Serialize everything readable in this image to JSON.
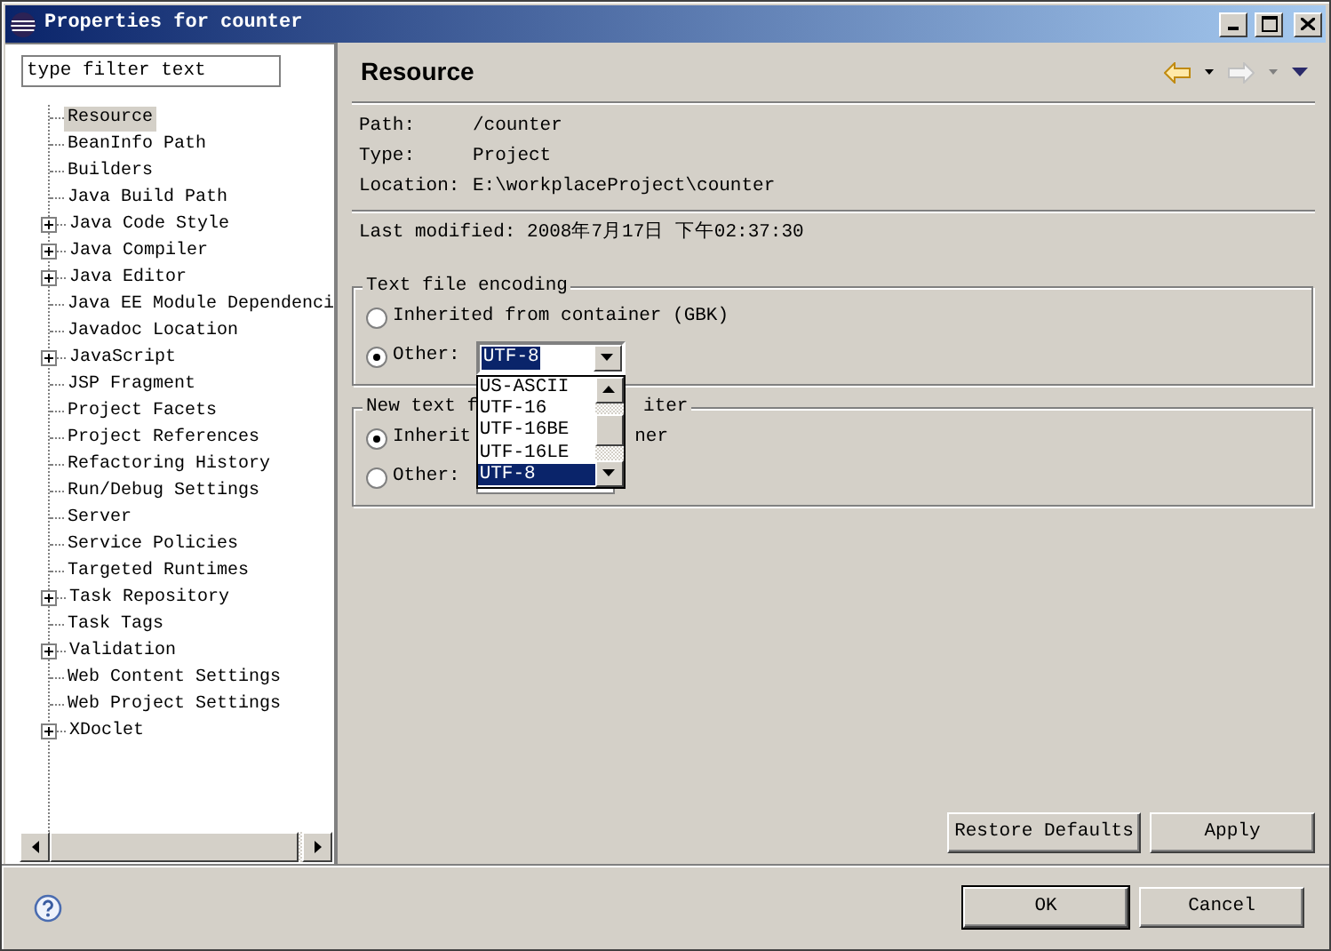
{
  "window": {
    "title": "Properties for counter"
  },
  "filter": {
    "placeholder": "type filter text"
  },
  "tree": [
    {
      "label": "Resource",
      "selected": true,
      "expandable": false
    },
    {
      "label": "BeanInfo Path",
      "selected": false,
      "expandable": false
    },
    {
      "label": "Builders",
      "selected": false,
      "expandable": false
    },
    {
      "label": "Java Build Path",
      "selected": false,
      "expandable": false
    },
    {
      "label": "Java Code Style",
      "selected": false,
      "expandable": true
    },
    {
      "label": "Java Compiler",
      "selected": false,
      "expandable": true
    },
    {
      "label": "Java Editor",
      "selected": false,
      "expandable": true
    },
    {
      "label": "Java EE Module Dependenci",
      "selected": false,
      "expandable": false
    },
    {
      "label": "Javadoc Location",
      "selected": false,
      "expandable": false
    },
    {
      "label": "JavaScript",
      "selected": false,
      "expandable": true
    },
    {
      "label": "JSP Fragment",
      "selected": false,
      "expandable": false
    },
    {
      "label": "Project Facets",
      "selected": false,
      "expandable": false
    },
    {
      "label": "Project References",
      "selected": false,
      "expandable": false
    },
    {
      "label": "Refactoring History",
      "selected": false,
      "expandable": false
    },
    {
      "label": "Run/Debug Settings",
      "selected": false,
      "expandable": false
    },
    {
      "label": "Server",
      "selected": false,
      "expandable": false
    },
    {
      "label": "Service Policies",
      "selected": false,
      "expandable": false
    },
    {
      "label": "Targeted Runtimes",
      "selected": false,
      "expandable": false
    },
    {
      "label": "Task Repository",
      "selected": false,
      "expandable": true
    },
    {
      "label": "Task Tags",
      "selected": false,
      "expandable": false
    },
    {
      "label": "Validation",
      "selected": false,
      "expandable": true
    },
    {
      "label": "Web Content Settings",
      "selected": false,
      "expandable": false
    },
    {
      "label": "Web Project Settings",
      "selected": false,
      "expandable": false
    },
    {
      "label": "XDoclet",
      "selected": false,
      "expandable": true
    }
  ],
  "page": {
    "title": "Resource",
    "info": [
      {
        "label": "Path:",
        "value": "/counter"
      },
      {
        "label": "Type:",
        "value": "Project"
      },
      {
        "label": "Location:",
        "value": "E:\\workplaceProject\\counter"
      }
    ],
    "last_modified": "Last modified: 2008年7月17日 下午02:37:30",
    "encoding_group": {
      "title": "Text file encoding",
      "radios": [
        {
          "label": "Inherited from container (GBK)",
          "checked": false
        },
        {
          "label": "Other:",
          "checked": true
        }
      ],
      "select_value": "UTF-8",
      "options": [
        {
          "label": "US-ASCII",
          "selected": false
        },
        {
          "label": "UTF-16",
          "selected": false
        },
        {
          "label": "UTF-16BE",
          "selected": false
        },
        {
          "label": "UTF-16LE",
          "selected": false
        },
        {
          "label": "UTF-8",
          "selected": true
        }
      ]
    },
    "delimiter_group": {
      "title_start": "New text f",
      "title_end": "iter",
      "radios": [
        {
          "label_start": "Inherit",
          "label_end": "ner",
          "checked": true
        },
        {
          "label_start": "Other:",
          "checked": false
        }
      ]
    },
    "buttons": [
      "Restore Defaults",
      "Apply"
    ]
  },
  "footer_buttons": [
    {
      "label": "OK",
      "default": true
    },
    {
      "label": "Cancel",
      "default": false
    }
  ]
}
